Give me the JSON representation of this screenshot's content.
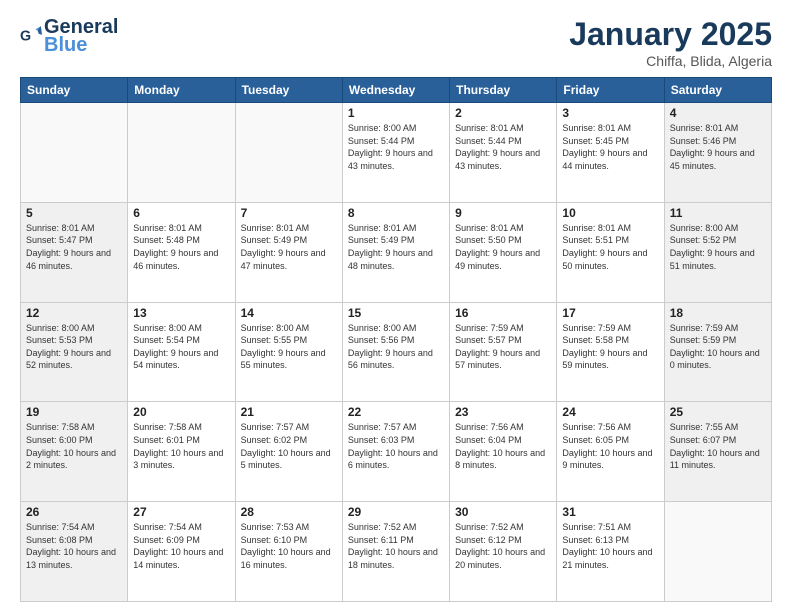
{
  "header": {
    "logo_general": "General",
    "logo_blue": "Blue",
    "month": "January 2025",
    "location": "Chiffa, Blida, Algeria"
  },
  "weekdays": [
    "Sunday",
    "Monday",
    "Tuesday",
    "Wednesday",
    "Thursday",
    "Friday",
    "Saturday"
  ],
  "weeks": [
    [
      {
        "day": "",
        "info": ""
      },
      {
        "day": "",
        "info": ""
      },
      {
        "day": "",
        "info": ""
      },
      {
        "day": "1",
        "info": "Sunrise: 8:00 AM\nSunset: 5:44 PM\nDaylight: 9 hours\nand 43 minutes."
      },
      {
        "day": "2",
        "info": "Sunrise: 8:01 AM\nSunset: 5:44 PM\nDaylight: 9 hours\nand 43 minutes."
      },
      {
        "day": "3",
        "info": "Sunrise: 8:01 AM\nSunset: 5:45 PM\nDaylight: 9 hours\nand 44 minutes."
      },
      {
        "day": "4",
        "info": "Sunrise: 8:01 AM\nSunset: 5:46 PM\nDaylight: 9 hours\nand 45 minutes."
      }
    ],
    [
      {
        "day": "5",
        "info": "Sunrise: 8:01 AM\nSunset: 5:47 PM\nDaylight: 9 hours\nand 46 minutes."
      },
      {
        "day": "6",
        "info": "Sunrise: 8:01 AM\nSunset: 5:48 PM\nDaylight: 9 hours\nand 46 minutes."
      },
      {
        "day": "7",
        "info": "Sunrise: 8:01 AM\nSunset: 5:49 PM\nDaylight: 9 hours\nand 47 minutes."
      },
      {
        "day": "8",
        "info": "Sunrise: 8:01 AM\nSunset: 5:49 PM\nDaylight: 9 hours\nand 48 minutes."
      },
      {
        "day": "9",
        "info": "Sunrise: 8:01 AM\nSunset: 5:50 PM\nDaylight: 9 hours\nand 49 minutes."
      },
      {
        "day": "10",
        "info": "Sunrise: 8:01 AM\nSunset: 5:51 PM\nDaylight: 9 hours\nand 50 minutes."
      },
      {
        "day": "11",
        "info": "Sunrise: 8:00 AM\nSunset: 5:52 PM\nDaylight: 9 hours\nand 51 minutes."
      }
    ],
    [
      {
        "day": "12",
        "info": "Sunrise: 8:00 AM\nSunset: 5:53 PM\nDaylight: 9 hours\nand 52 minutes."
      },
      {
        "day": "13",
        "info": "Sunrise: 8:00 AM\nSunset: 5:54 PM\nDaylight: 9 hours\nand 54 minutes."
      },
      {
        "day": "14",
        "info": "Sunrise: 8:00 AM\nSunset: 5:55 PM\nDaylight: 9 hours\nand 55 minutes."
      },
      {
        "day": "15",
        "info": "Sunrise: 8:00 AM\nSunset: 5:56 PM\nDaylight: 9 hours\nand 56 minutes."
      },
      {
        "day": "16",
        "info": "Sunrise: 7:59 AM\nSunset: 5:57 PM\nDaylight: 9 hours\nand 57 minutes."
      },
      {
        "day": "17",
        "info": "Sunrise: 7:59 AM\nSunset: 5:58 PM\nDaylight: 9 hours\nand 59 minutes."
      },
      {
        "day": "18",
        "info": "Sunrise: 7:59 AM\nSunset: 5:59 PM\nDaylight: 10 hours\nand 0 minutes."
      }
    ],
    [
      {
        "day": "19",
        "info": "Sunrise: 7:58 AM\nSunset: 6:00 PM\nDaylight: 10 hours\nand 2 minutes."
      },
      {
        "day": "20",
        "info": "Sunrise: 7:58 AM\nSunset: 6:01 PM\nDaylight: 10 hours\nand 3 minutes."
      },
      {
        "day": "21",
        "info": "Sunrise: 7:57 AM\nSunset: 6:02 PM\nDaylight: 10 hours\nand 5 minutes."
      },
      {
        "day": "22",
        "info": "Sunrise: 7:57 AM\nSunset: 6:03 PM\nDaylight: 10 hours\nand 6 minutes."
      },
      {
        "day": "23",
        "info": "Sunrise: 7:56 AM\nSunset: 6:04 PM\nDaylight: 10 hours\nand 8 minutes."
      },
      {
        "day": "24",
        "info": "Sunrise: 7:56 AM\nSunset: 6:05 PM\nDaylight: 10 hours\nand 9 minutes."
      },
      {
        "day": "25",
        "info": "Sunrise: 7:55 AM\nSunset: 6:07 PM\nDaylight: 10 hours\nand 11 minutes."
      }
    ],
    [
      {
        "day": "26",
        "info": "Sunrise: 7:54 AM\nSunset: 6:08 PM\nDaylight: 10 hours\nand 13 minutes."
      },
      {
        "day": "27",
        "info": "Sunrise: 7:54 AM\nSunset: 6:09 PM\nDaylight: 10 hours\nand 14 minutes."
      },
      {
        "day": "28",
        "info": "Sunrise: 7:53 AM\nSunset: 6:10 PM\nDaylight: 10 hours\nand 16 minutes."
      },
      {
        "day": "29",
        "info": "Sunrise: 7:52 AM\nSunset: 6:11 PM\nDaylight: 10 hours\nand 18 minutes."
      },
      {
        "day": "30",
        "info": "Sunrise: 7:52 AM\nSunset: 6:12 PM\nDaylight: 10 hours\nand 20 minutes."
      },
      {
        "day": "31",
        "info": "Sunrise: 7:51 AM\nSunset: 6:13 PM\nDaylight: 10 hours\nand 21 minutes."
      },
      {
        "day": "",
        "info": ""
      }
    ]
  ]
}
